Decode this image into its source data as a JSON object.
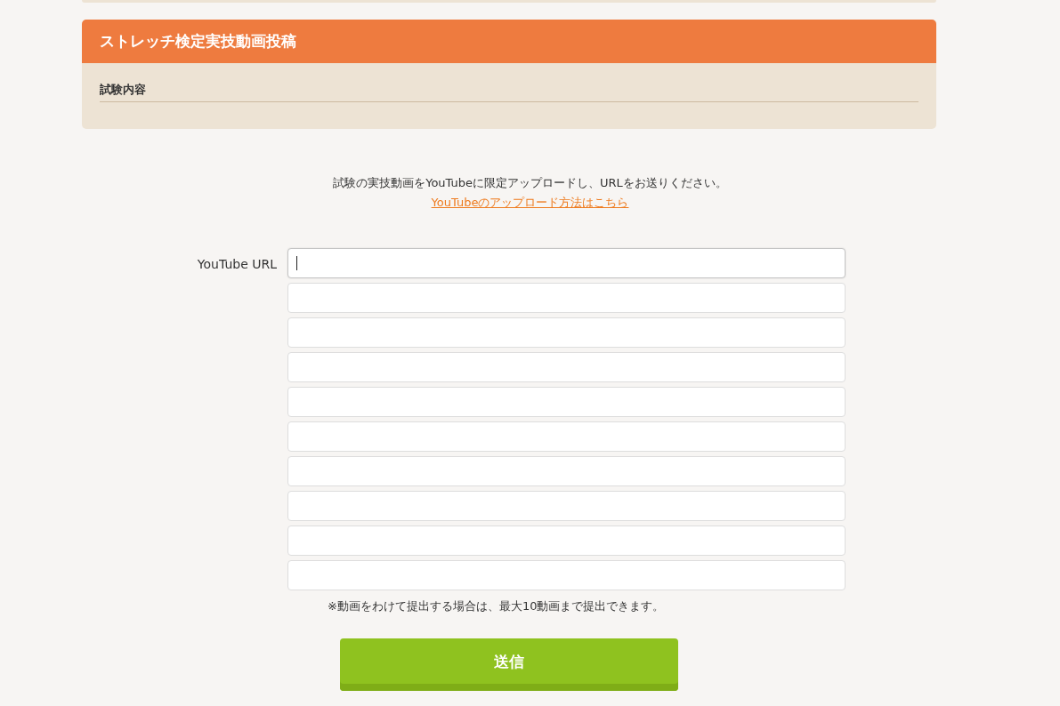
{
  "section": {
    "title": "ストレッチ検定実技動画投稿",
    "subheading": "試験内容"
  },
  "instructions": {
    "text": "試験の実技動画をYouTubeに限定アップロードし、URLをお送りください。",
    "link": "YouTubeのアップロード方法はこちら"
  },
  "form": {
    "label": "YouTube URL",
    "fields": [
      {
        "focused": true
      },
      {
        "focused": false
      },
      {
        "focused": false
      },
      {
        "focused": false
      },
      {
        "focused": false
      },
      {
        "focused": false
      },
      {
        "focused": false
      },
      {
        "focused": false
      },
      {
        "focused": false
      },
      {
        "focused": false
      }
    ],
    "note": "※動画をわけて提出する場合は、最大10動画まで提出できます。",
    "submit": "送信"
  }
}
